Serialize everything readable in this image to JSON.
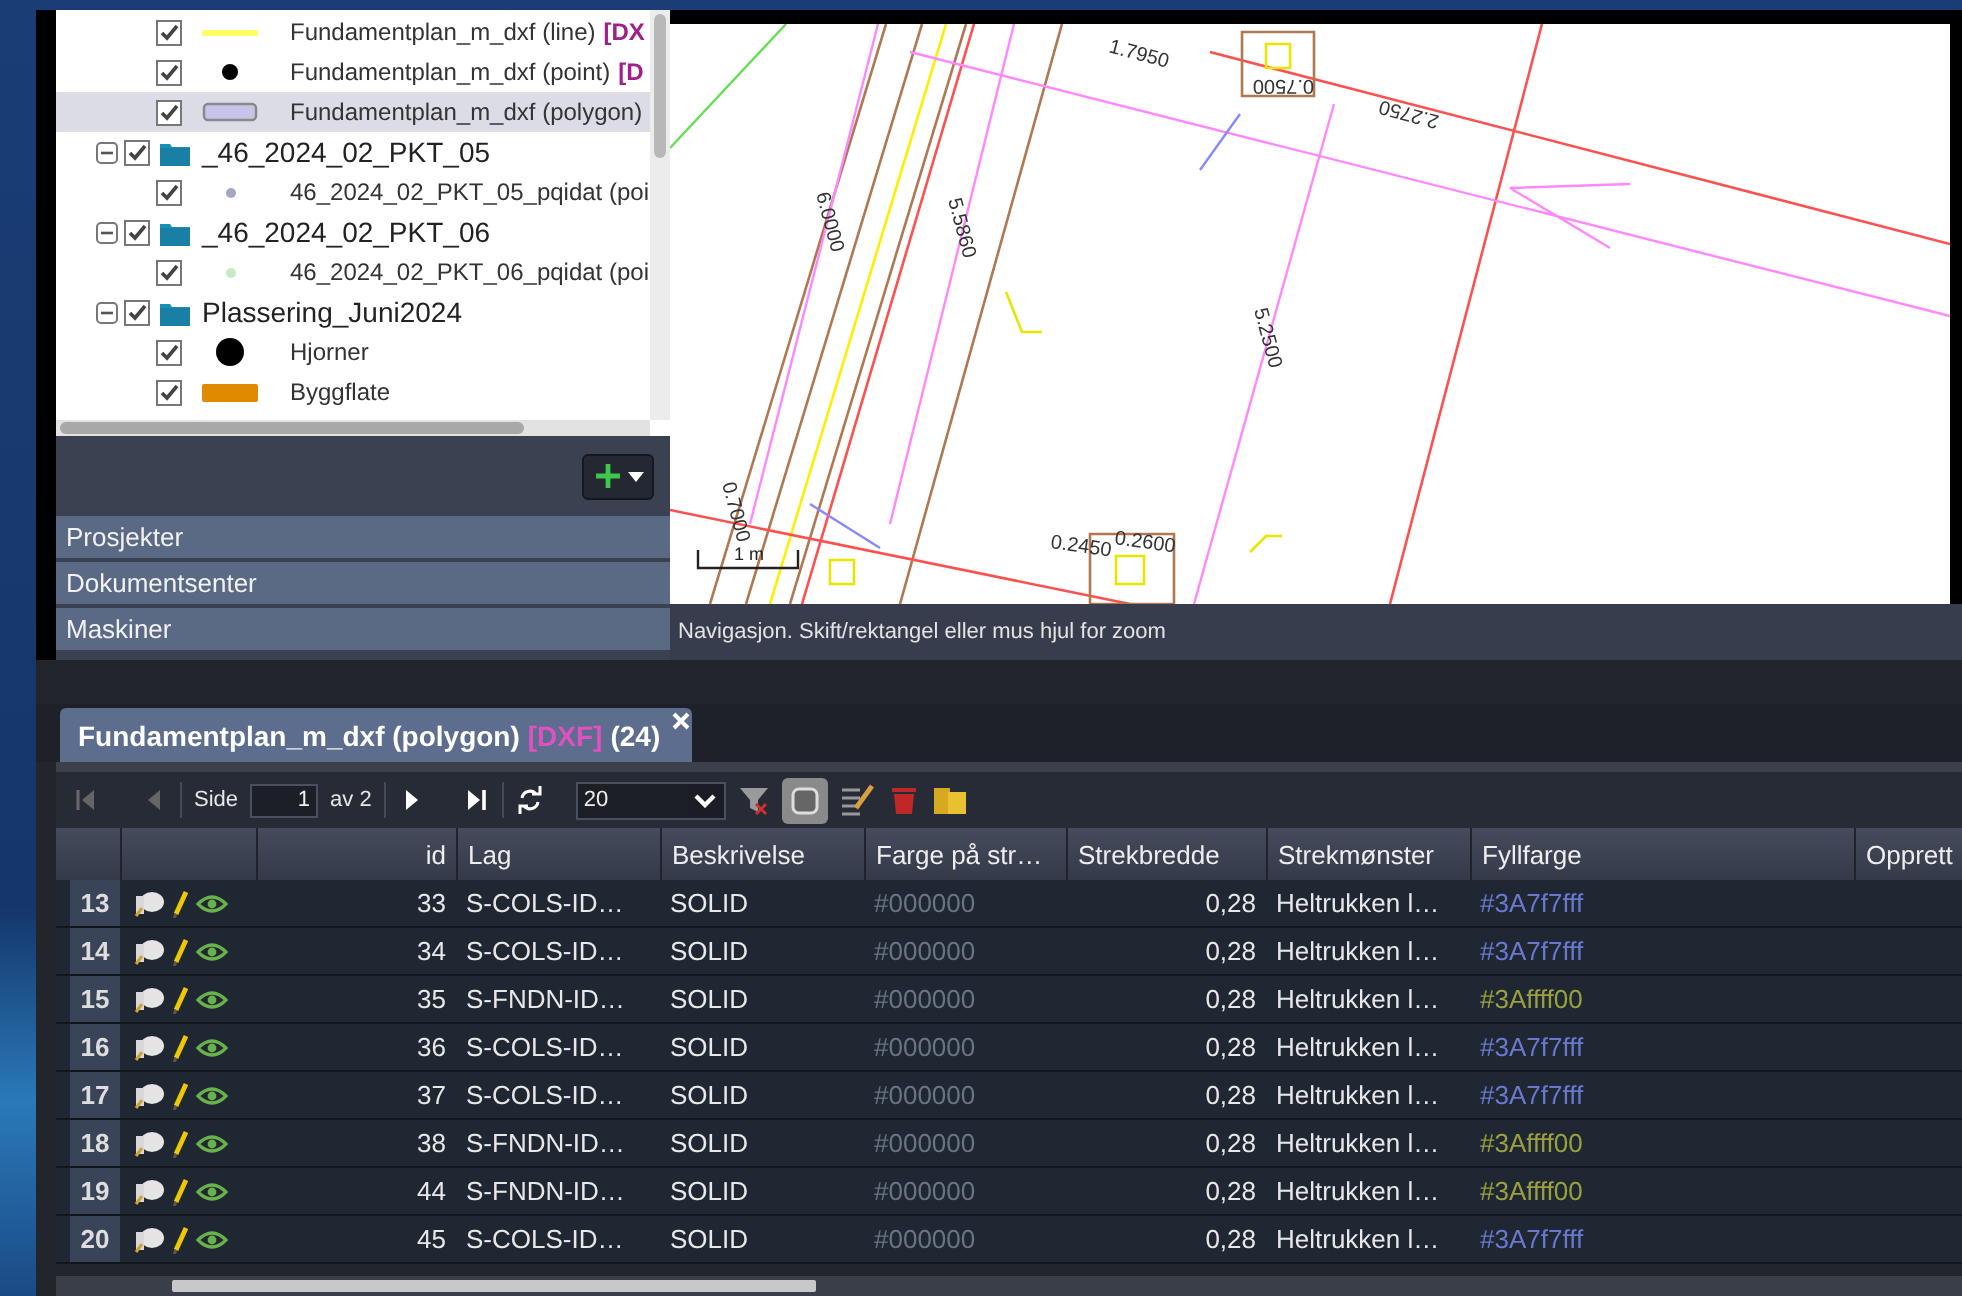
{
  "layers": {
    "items": [
      {
        "label": "Fundamentplan_m_dxf (line)",
        "tag": "[DX",
        "kind": "line",
        "color": "#ffff66",
        "checked": true,
        "selected": false
      },
      {
        "label": "Fundamentplan_m_dxf (point)",
        "tag": "[D",
        "kind": "point",
        "color": "#000000",
        "checked": true,
        "selected": false
      },
      {
        "label": "Fundamentplan_m_dxf (polygon)",
        "kind": "polygon",
        "color": "#c8c4e8",
        "checked": true,
        "selected": true
      },
      {
        "label": "_46_2024_02_PKT_05",
        "kind": "group",
        "checked": true,
        "expanded": true,
        "selected": false,
        "children": [
          {
            "label": "46_2024_02_PKT_05_pqidat (poi",
            "kind": "dot",
            "color": "#a4a8c4",
            "checked": true,
            "selected": false
          }
        ]
      },
      {
        "label": "_46_2024_02_PKT_06",
        "kind": "group",
        "checked": true,
        "expanded": true,
        "selected": false,
        "children": [
          {
            "label": "46_2024_02_PKT_06_pqidat (poi",
            "kind": "dot",
            "color": "#c4ecc4",
            "checked": true,
            "selected": false
          }
        ]
      },
      {
        "label": "Plassering_Juni2024",
        "kind": "group",
        "checked": true,
        "expanded": true,
        "selected": false,
        "children": [
          {
            "label": "Hjorner",
            "kind": "circle",
            "color": "#000000",
            "checked": true,
            "selected": false
          },
          {
            "label": "Byggflate",
            "kind": "rect",
            "color": "#e08a00",
            "checked": true,
            "selected": false
          }
        ]
      }
    ]
  },
  "sidebar": {
    "sections": [
      "Prosjekter",
      "Dokumentsenter",
      "Maskiner"
    ]
  },
  "map": {
    "labels": [
      "1.7950",
      "0.7500",
      "2.2750",
      "6.0000",
      "5.5860",
      "5.2500",
      "0.2450",
      "0.2600",
      "0.7000"
    ],
    "scale": "1 m",
    "status": "Navigasjon. Skift/rektangel eller mus hjul for zoom"
  },
  "tabs": [
    {
      "title": "Fundamentplan_m_dxf (polygon)",
      "tag": "[DXF]",
      "count": "(24)",
      "selected": true
    }
  ],
  "toolbar": {
    "page_label": "Side",
    "page": "1",
    "page_total": "av 2",
    "page_size": "20",
    "first_disabled": true,
    "prev_disabled": true,
    "geometry_toggle_on": true
  },
  "table": {
    "columns": [
      "id",
      "Lag",
      "Beskrivelse",
      "Farge på str…",
      "Strekbredde",
      "Strekmønster",
      "Fyllfarge",
      "Opprett"
    ],
    "rows": [
      {
        "num": "13",
        "id": "33",
        "lag": "S-COLS-ID…",
        "beskrivelse": "SOLID",
        "farge": "#000000",
        "strekbredde": "0,28",
        "strekmonster": "Heltrukken l…",
        "fyllfarge": "#3A7f7fff",
        "color": "#6a78d0"
      },
      {
        "num": "14",
        "id": "34",
        "lag": "S-COLS-ID…",
        "beskrivelse": "SOLID",
        "farge": "#000000",
        "strekbredde": "0,28",
        "strekmonster": "Heltrukken l…",
        "fyllfarge": "#3A7f7fff",
        "color": "#6a78d0"
      },
      {
        "num": "15",
        "id": "35",
        "lag": "S-FNDN-ID…",
        "beskrivelse": "SOLID",
        "farge": "#000000",
        "strekbredde": "0,28",
        "strekmonster": "Heltrukken l…",
        "fyllfarge": "#3Affff00",
        "color": "#9aa040"
      },
      {
        "num": "16",
        "id": "36",
        "lag": "S-COLS-ID…",
        "beskrivelse": "SOLID",
        "farge": "#000000",
        "strekbredde": "0,28",
        "strekmonster": "Heltrukken l…",
        "fyllfarge": "#3A7f7fff",
        "color": "#6a78d0"
      },
      {
        "num": "17",
        "id": "37",
        "lag": "S-COLS-ID…",
        "beskrivelse": "SOLID",
        "farge": "#000000",
        "strekbredde": "0,28",
        "strekmonster": "Heltrukken l…",
        "fyllfarge": "#3A7f7fff",
        "color": "#6a78d0"
      },
      {
        "num": "18",
        "id": "38",
        "lag": "S-FNDN-ID…",
        "beskrivelse": "SOLID",
        "farge": "#000000",
        "strekbredde": "0,28",
        "strekmonster": "Heltrukken l…",
        "fyllfarge": "#3Affff00",
        "color": "#9aa040"
      },
      {
        "num": "19",
        "id": "44",
        "lag": "S-FNDN-ID…",
        "beskrivelse": "SOLID",
        "farge": "#000000",
        "strekbredde": "0,28",
        "strekmonster": "Heltrukken l…",
        "fyllfarge": "#3Affff00",
        "color": "#9aa040"
      },
      {
        "num": "20",
        "id": "45",
        "lag": "S-COLS-ID…",
        "beskrivelse": "SOLID",
        "farge": "#000000",
        "strekbredde": "0,28",
        "strekmonster": "Heltrukken l…",
        "fyllfarge": "#3A7f7fff",
        "color": "#6a78d0"
      }
    ]
  }
}
